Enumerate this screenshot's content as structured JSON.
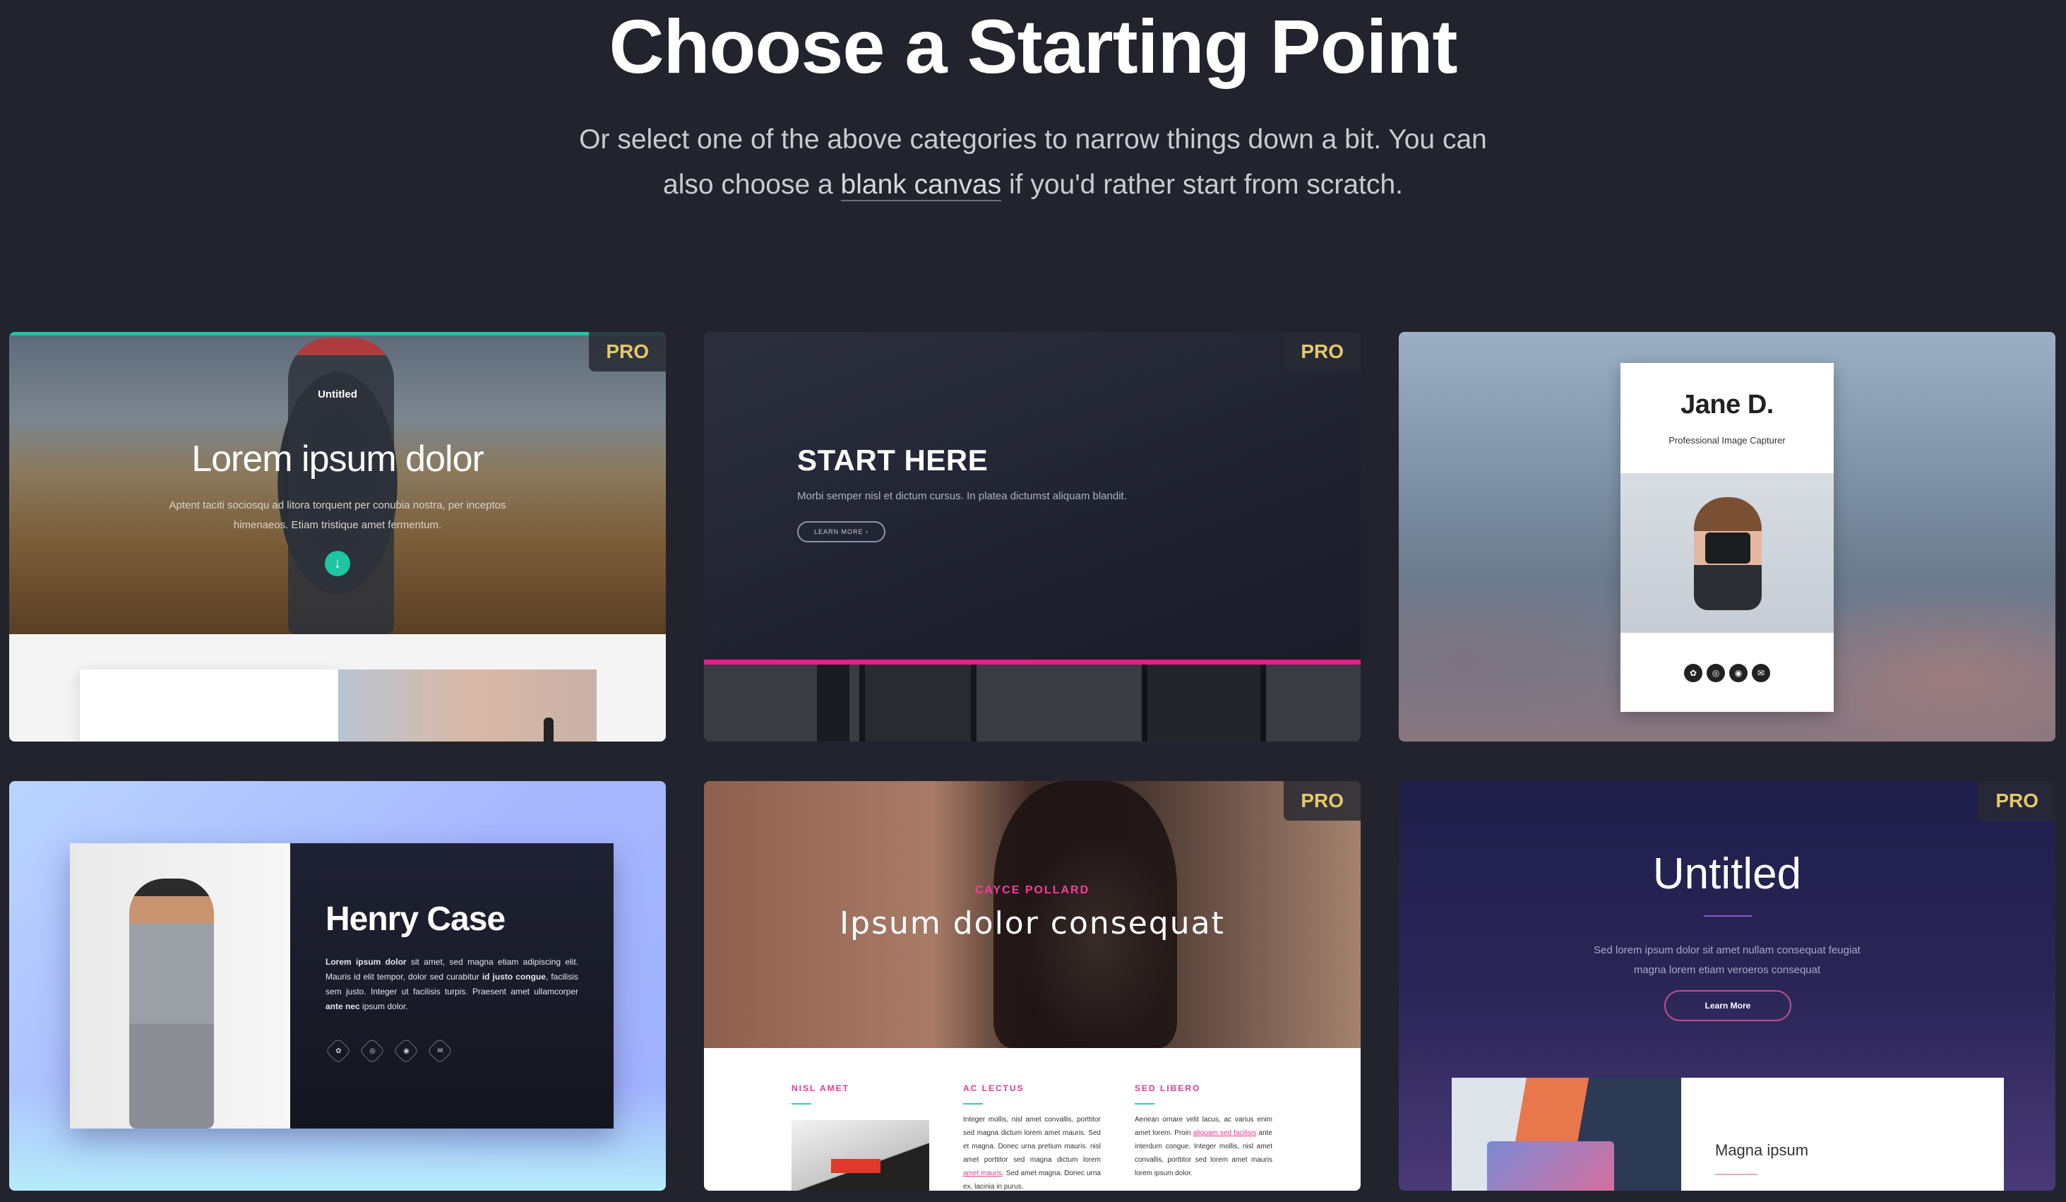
{
  "header": {
    "title": "Choose a Starting Point",
    "subtitle_line1": "Or select one of the above categories to narrow things down a bit. You can",
    "subtitle_pre": "also choose a ",
    "subtitle_link": "blank canvas",
    "subtitle_post": " if you'd rather start from scratch."
  },
  "badge": "PRO",
  "templates": [
    {
      "pro": true,
      "brand": "Untitled",
      "headline": "Lorem ipsum dolor",
      "desc": "Aptent taciti sociosqu ad litora torquent per conubia nostra, per inceptos himenaeos. Etiam tristique amet fermentum.",
      "button_icon": "arrow-down-icon"
    },
    {
      "pro": true,
      "headline": "START HERE",
      "desc": "Morbi semper nisl et dictum cursus. In platea dictumst aliquam blandit.",
      "button": "LEARN MORE",
      "accent": "#ec1b8c"
    },
    {
      "pro": false,
      "name": "Jane D.",
      "role": "Professional Image Capturer",
      "socials": [
        "twitter-icon",
        "instagram-icon",
        "camera-icon",
        "mail-icon"
      ]
    },
    {
      "pro": false,
      "name": "Henry Case",
      "bio_b1": "Lorem ipsum dolor",
      "bio_1": " sit amet, sed magna etiam adipiscing elit. Mauris id elit tempor, dolor sed curabitur ",
      "bio_b2": "id justo congue",
      "bio_2": ", facilisis sem justo. Integer ut facilisis turpis. Praesent amet ullamcorper ",
      "bio_b3": "ante nec",
      "bio_3": " ipsum dolor.",
      "socials": [
        "twitter-icon",
        "instagram-icon",
        "camera-icon",
        "mail-icon"
      ]
    },
    {
      "pro": true,
      "eyebrow": "CAYCE POLLARD",
      "headline": "Ipsum dolor consequat",
      "columns": [
        {
          "title": "NISL AMET"
        },
        {
          "title": "AC LECTUS",
          "text1": "Integer mollis, nisl amet convallis, porttitor sed magna dictum lorem amet mauris. Sed et magna. Donec urna pretium mauris. nisl amet porttitor sed magna dictum lorem ",
          "link": "amet mauris",
          "text2": ". Sed amet magna. Donec urna ex, lacinia in purus."
        },
        {
          "title": "SED LIBERO",
          "text1": "Aenean ornare velit lacus, ac varius enim amet lorem. Proin ",
          "link": "aliquam sed facilisis",
          "text2": " ante interdum congue. Integer mollis, nisl amet convallis, porttitor sed lorem amet mauris lorem ipsum dolor."
        }
      ]
    },
    {
      "pro": true,
      "headline": "Untitled",
      "desc": "Sed lorem ipsum dolor sit amet nullam consequat feugiat magna lorem etiam veroeros consequat",
      "button": "Learn More",
      "card_title": "Magna ipsum"
    }
  ]
}
